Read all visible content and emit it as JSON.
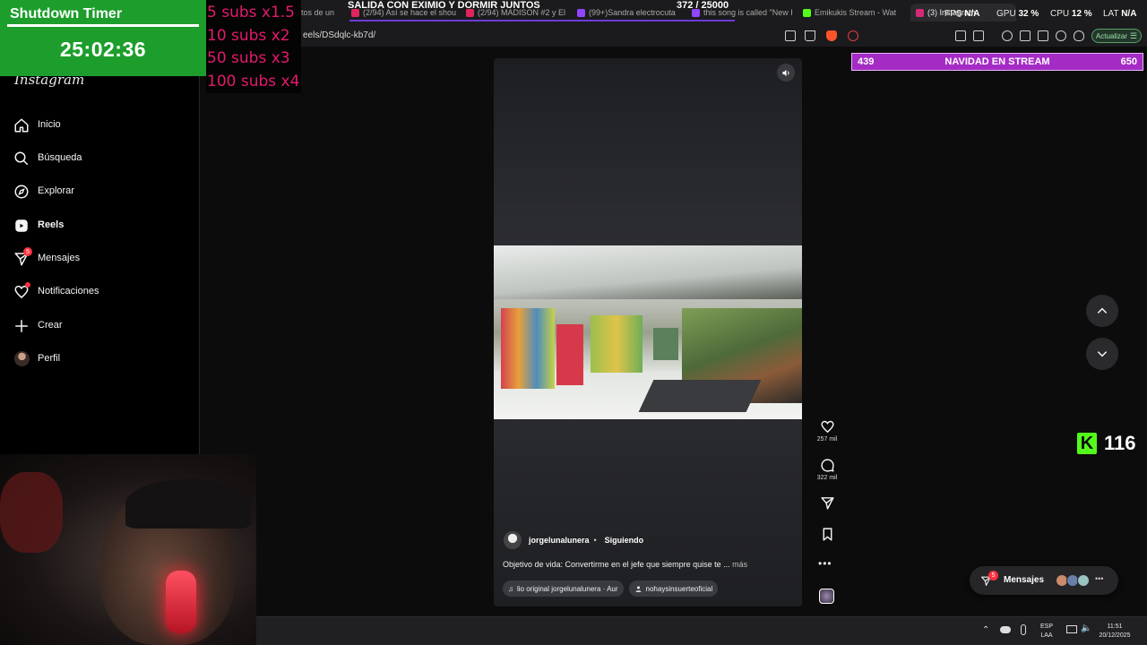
{
  "browser": {
    "tabs": [
      {
        "title": "tos de un",
        "active": false
      },
      {
        "title": "(2/94) Así se hace el shou",
        "active": false
      },
      {
        "title": "(2/94) MADISON #2 y El",
        "active": false
      },
      {
        "title": "(99+)Sandra electrocuta",
        "active": false
      },
      {
        "title": "this song is called \"New H",
        "active": false
      },
      {
        "title": "Emikukis Stream - Wat",
        "active": false
      },
      {
        "title": "(3) Instagram",
        "active": true
      }
    ],
    "url": "eels/DSdqlc-kb7d/",
    "update_label": "Actualizar"
  },
  "overlays": {
    "timer_title": "Shutdown Timer",
    "timer_value": "25:02:36",
    "subs_multipliers": [
      "5 subs x1.5",
      "10 subs x2",
      "50 subs x3",
      "100 subs x4"
    ],
    "goal_title": "SALIDA CON EXIMIO Y DORMIR JUNTOS",
    "goal_count": "372  / 25000",
    "navidad_left": "439",
    "navidad_title": "NAVIDAD EN STREAM",
    "navidad_right": "650",
    "fps_label": "FPS",
    "fps_value": "N/A",
    "gpu_label": "GPU",
    "gpu_value": "32 %",
    "cpu_label": "CPU",
    "cpu_value": "12 %",
    "lat_label": "LAT",
    "lat_value": "N/A",
    "kick_count": "116"
  },
  "sidebar": {
    "logo": "Instagram",
    "items": [
      {
        "label": "Inicio",
        "icon": "home-icon"
      },
      {
        "label": "Búsqueda",
        "icon": "search-icon"
      },
      {
        "label": "Explorar",
        "icon": "compass-icon"
      },
      {
        "label": "Reels",
        "icon": "reels-icon"
      },
      {
        "label": "Mensajes",
        "icon": "messenger-icon",
        "badge": "5"
      },
      {
        "label": "Notificaciones",
        "icon": "heart-icon"
      },
      {
        "label": "Crear",
        "icon": "plus-icon"
      },
      {
        "label": "Perfil",
        "icon": "avatar"
      }
    ]
  },
  "reel": {
    "author": "jorgelunalunera",
    "follow_label": "Siguiendo",
    "caption": "Objetivo de vida: Convertirme en el jefe que siempre quise te ...",
    "caption_more": "más",
    "audio_label": "lio original  jorgelunalunera · Aur",
    "tagged_user": "nohaysinsuerteoficial",
    "likes": "257 mil",
    "comments": "322 mil"
  },
  "messages_pill": {
    "label": "Mensajes",
    "badge": "5"
  },
  "taskbar": {
    "lang_top": "ESP",
    "lang_bottom": "LAA",
    "time": "11:51",
    "date": "20/12/2025"
  },
  "colors": {
    "timer_bg": "#1d9e2c",
    "subs_text": "#e31b6d",
    "navidad_bg": "#a42cc5",
    "kick_green": "#53fc18",
    "badge_red": "#ff3040"
  }
}
